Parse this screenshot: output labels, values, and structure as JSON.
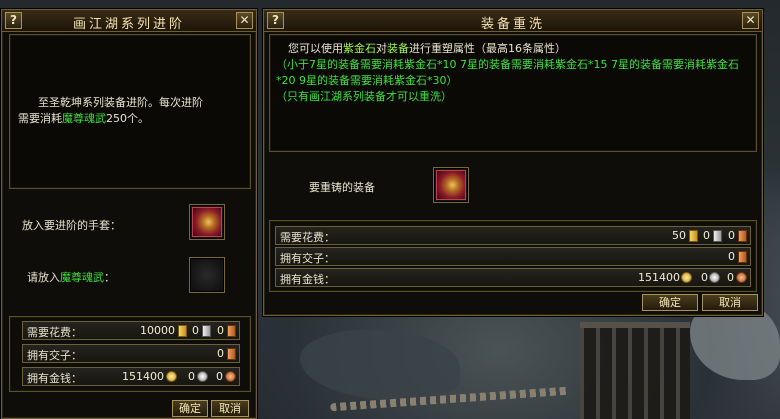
{
  "left_panel": {
    "help": "?",
    "title": "画江湖系列进阶",
    "close": "✕",
    "desc_line1": "至圣乾坤系列装备进阶。每次进阶",
    "desc_prefix": "需要消耗",
    "desc_item": "魔尊魂武",
    "desc_suffix": "250个。",
    "slot1_label": "放入要进阶的手套：",
    "slot2_prefix": "请放入",
    "slot2_item": "魔尊魂武",
    "slot2_suffix": "：",
    "rows": [
      {
        "label": "需要花费：",
        "gold": "10000",
        "silver": "0",
        "copper": "0"
      },
      {
        "label": "拥有交子：",
        "value": "0"
      },
      {
        "label": "拥有金钱：",
        "gold": "151400",
        "silver": "0",
        "copper": "0"
      }
    ],
    "confirm": "确定",
    "cancel": "取消"
  },
  "right_panel": {
    "help": "?",
    "title": "装备重洗",
    "close": "✕",
    "line1_prefix": "您可以使用",
    "line1_item": "紫金石",
    "line1_mid": "对",
    "line1_item2": "装备",
    "line1_suffix": "进行重塑属性（最高16条属性）",
    "line2": "（小于7星的装备需要消耗紫金石*10 7星的装备需要消耗紫金石*15 7星的装备需要消耗紫金石*20 9星的装备需要消耗紫金石*30）",
    "line3": "（只有画江湖系列装备才可以重洗）",
    "slot_label": "要重铸的装备",
    "rows": [
      {
        "label": "需要花费：",
        "gold": "50",
        "silver": "0",
        "copper": "0"
      },
      {
        "label": "拥有交子：",
        "value": "0"
      },
      {
        "label": "拥有金钱：",
        "gold": "151400",
        "silver": "0",
        "copper": "0"
      }
    ],
    "confirm": "确定",
    "cancel": "取消"
  }
}
